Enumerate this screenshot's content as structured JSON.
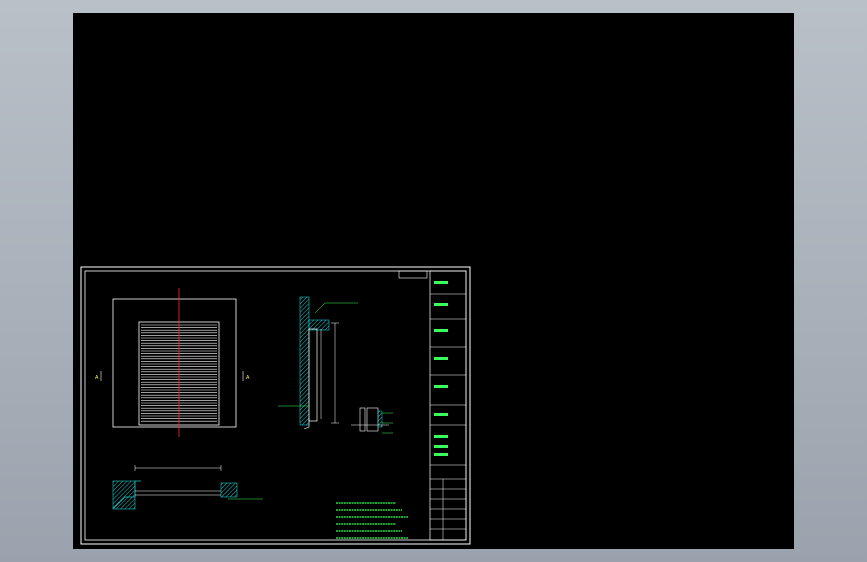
{
  "views": {
    "front": {
      "caption": ""
    },
    "side": {
      "caption": ""
    },
    "section": {
      "caption": ""
    }
  },
  "section_markers": {
    "left": "A",
    "right": "A"
  },
  "notes": {
    "heading": "",
    "lines": []
  },
  "title_block": {
    "top_label": ""
  },
  "colors": {
    "background": "#000000",
    "outer_chrome": "#aeb6bf",
    "frame": "#ffffff",
    "annotation": "#39ff5a",
    "hatch": "#19c8c8",
    "center_line": "#ff2a2a",
    "marker": "#ffff33"
  }
}
